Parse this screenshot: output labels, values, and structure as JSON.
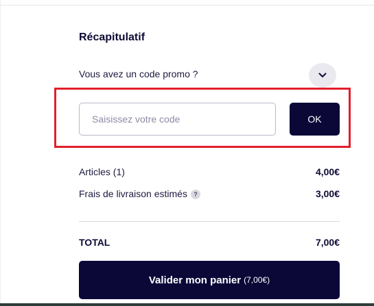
{
  "summary": {
    "title": "Récapitulatif"
  },
  "promo": {
    "question": "Vous avez un code promo ?",
    "toggle_icon": "chevron-down-icon",
    "input_placeholder": "Saisissez votre code",
    "input_value": "",
    "ok_label": "OK",
    "highlight_color": "#e31d2b"
  },
  "lines": {
    "articles_label": "Articles (1)",
    "articles_amount": "4,00€",
    "shipping_label": "Frais de livraison estimés",
    "shipping_help": "?",
    "shipping_amount": "3,00€"
  },
  "total": {
    "label": "TOTAL",
    "amount": "7,00€"
  },
  "checkout": {
    "label": "Valider mon panier",
    "amount": "(7,00€)",
    "color": "#0b0838"
  }
}
